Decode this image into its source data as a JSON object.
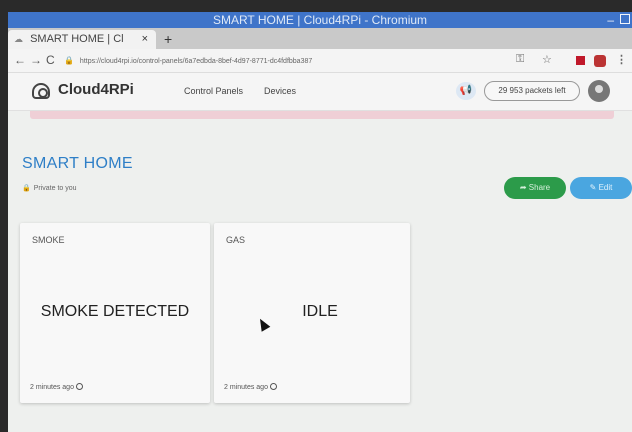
{
  "window": {
    "title": "SMART HOME | Cloud4RPi - Chromium",
    "minimize": "–"
  },
  "tab": {
    "label": "SMART HOME | Cl",
    "close": "×",
    "new_tab": "+"
  },
  "address": {
    "back": "←",
    "forward": "→",
    "reload": "C",
    "url": "https://cloud4rpi.io/control-panels/6a7edbda-8bef-4d97-8771-dc4fdfbba387",
    "key_icon": "key-icon",
    "star_icon": "star-icon",
    "menu": "⋮"
  },
  "header": {
    "logo": "Cloud4RPi",
    "nav": [
      "Control Panels",
      "Devices"
    ],
    "packets": "29 953 packets left"
  },
  "panel": {
    "title": "SMART HOME",
    "privacy": "Private to you",
    "share_label": "Share",
    "edit_label": "Edit"
  },
  "widgets": [
    {
      "title": "SMOKE",
      "value": "SMOKE DETECTED",
      "time": "2 minutes ago"
    },
    {
      "title": "GAS",
      "value": "IDLE",
      "time": "2 minutes ago"
    }
  ],
  "colors": {
    "accent": "#2e7fc7",
    "share": "#2c9b4a",
    "edit": "#4aa6e0",
    "titlebar": "#3f74c9"
  }
}
